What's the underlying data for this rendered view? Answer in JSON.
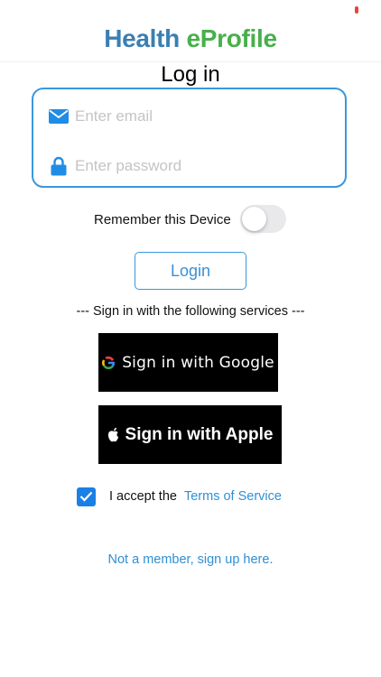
{
  "app": {
    "logo_part1": "Health",
    "logo_part2": "eProfile",
    "brand_blue": "#3a7fb2",
    "brand_green": "#47b04b"
  },
  "login": {
    "title": "Log in",
    "email_placeholder": "Enter email",
    "email_value": "",
    "email_icon": "envelope-icon",
    "password_placeholder": "Enter password",
    "password_value": "",
    "password_icon": "lock-icon",
    "accent_color": "#3a97dd"
  },
  "remember": {
    "label": "Remember this Device",
    "enabled": false
  },
  "buttons": {
    "login_label": "Login",
    "divider_text": "--- Sign in with the following services ---",
    "google_label": "Sign in with Google",
    "google_icon": "google-g-icon",
    "apple_label": "Sign in with Apple",
    "apple_icon": "apple-icon"
  },
  "terms": {
    "checked": true,
    "text": "I accept the",
    "link_text": "Terms of Service"
  },
  "signup": {
    "link_text": "Not a member, sign up here."
  }
}
